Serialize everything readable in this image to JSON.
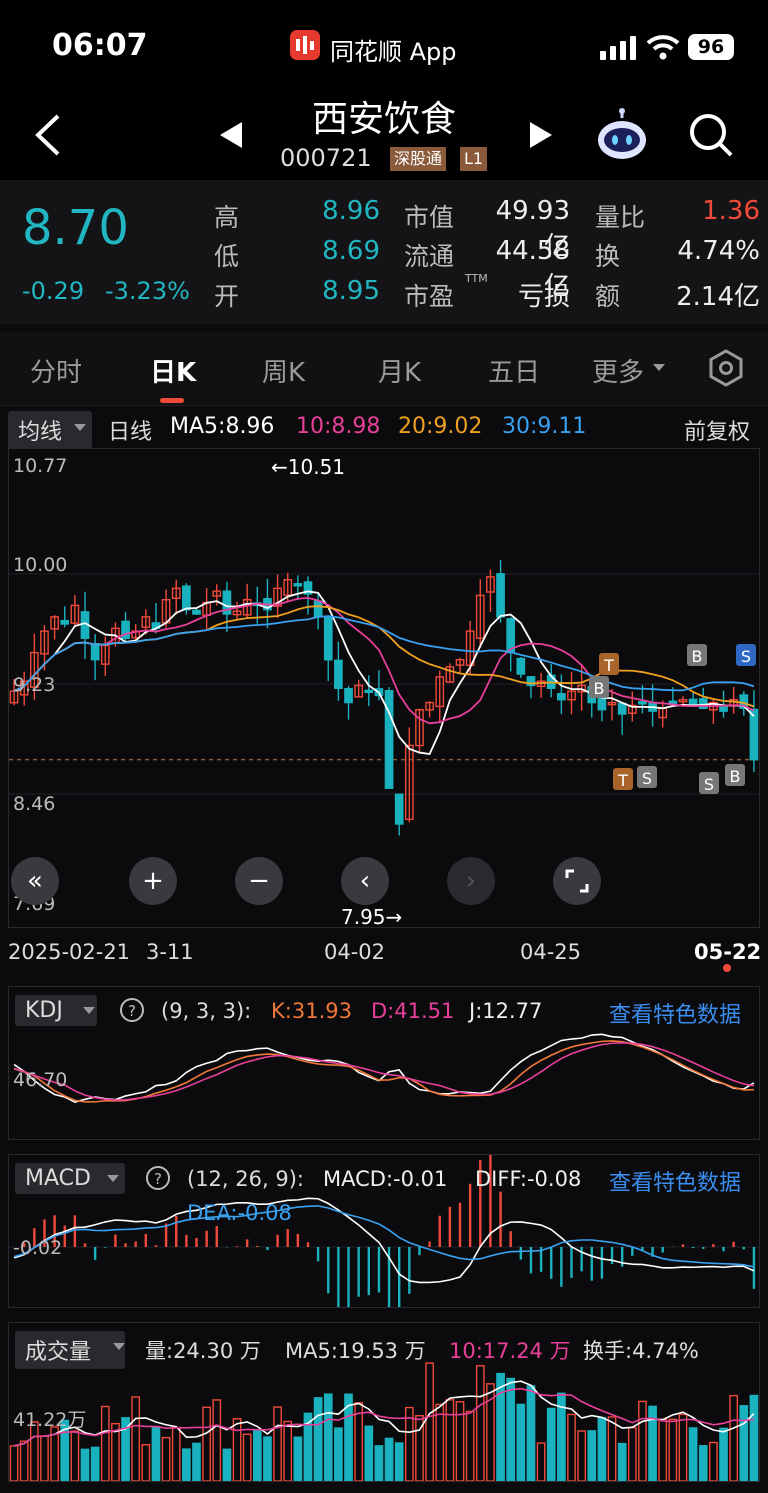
{
  "status_bar": {
    "time": "06:07",
    "app_name": "同花顺 App",
    "battery": "96"
  },
  "header": {
    "stock_name": "西安饮食",
    "stock_code": "000721",
    "badge_market": "深股通",
    "badge_level": "L1"
  },
  "quote": {
    "price": "8.70",
    "change": "-0.29",
    "change_pct": "-3.23%",
    "labels": {
      "high": "高",
      "low": "低",
      "open": "开",
      "mkt_cap": "市值",
      "float": "流通",
      "pe": "市盈",
      "pe_sup": "TTM",
      "vol_ratio": "量比",
      "turnover": "换",
      "amount": "额"
    },
    "high": "8.96",
    "low": "8.69",
    "open": "8.95",
    "mkt_cap": "49.93亿",
    "float_cap": "44.58亿",
    "pe": "亏损",
    "vol_ratio": "1.36",
    "turnover": "4.74%",
    "amount": "2.14亿"
  },
  "tabs": [
    "分时",
    "日K",
    "周K",
    "月K",
    "五日",
    "更多"
  ],
  "active_tab": "日K",
  "ma_bar": {
    "selector": "均线",
    "period": "日线",
    "ma5": "MA5:8.96",
    "ma10": "10:8.98",
    "ma20": "20:9.02",
    "ma30": "30:9.11",
    "adjust": "前复权"
  },
  "kline": {
    "y_labels": [
      "10.77",
      "10.00",
      "9.23",
      "8.46",
      "7.69"
    ],
    "high_label": "←10.51",
    "low_label": "7.95→",
    "dates": [
      "2025-02-21",
      "3-11",
      "04-02",
      "04-25",
      "05-22"
    ]
  },
  "kdj": {
    "selector": "KDJ",
    "params": "(9, 3, 3):",
    "k": "K:31.93",
    "d": "D:41.51",
    "j": "J:12.77",
    "link": "查看特色数据",
    "y_label": "46.70"
  },
  "macd": {
    "selector": "MACD",
    "params": "(12, 26, 9):",
    "macd": "MACD:-0.01",
    "diff": "DIFF:-0.08",
    "dea": "DEA:-0.08",
    "link": "查看特色数据",
    "y_label": "-0.02"
  },
  "volume": {
    "selector": "成交量",
    "vol": "量:24.30 万",
    "ma5": "MA5:19.53 万",
    "ma10": "10:17.24 万",
    "turnover": "换手:4.74%",
    "y_label": "41.22万"
  },
  "signals": {
    "buy": "B",
    "sell": "S",
    "t": "T"
  },
  "colors": {
    "up": "#f04a3a",
    "down": "#19b2be",
    "ma5": "#ffffff",
    "ma10": "#e8409a",
    "ma20": "#f0a020",
    "ma30": "#3aa0f0",
    "link": "#3a8ef0",
    "price": "#21b6c2"
  }
}
